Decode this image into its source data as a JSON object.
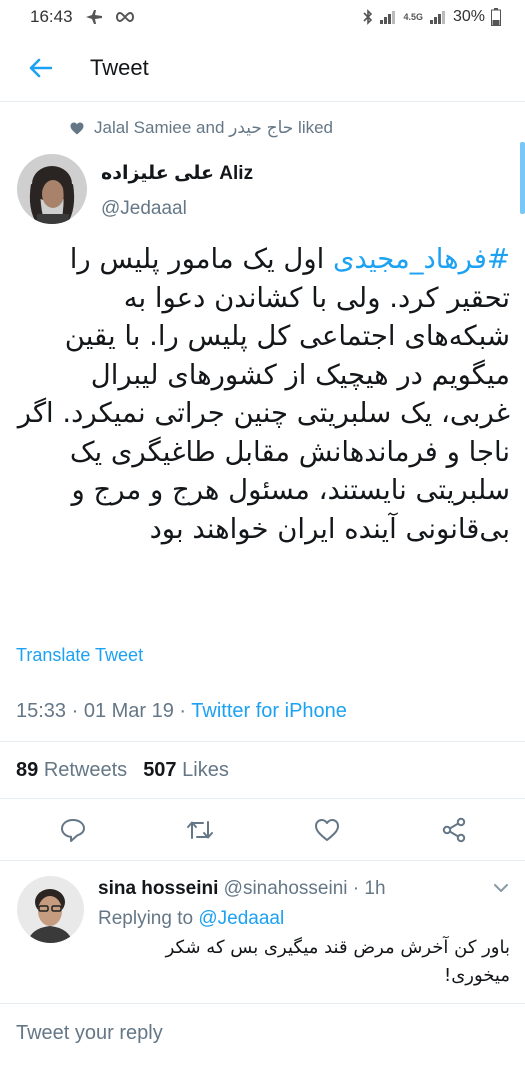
{
  "status_bar": {
    "time": "16:43",
    "network_label": "4.5G",
    "battery": "30%"
  },
  "app_bar": {
    "title": "Tweet"
  },
  "social_context": {
    "text": "Jalal Samiee and حاج حیدر liked"
  },
  "tweet": {
    "author_name": "علی علیزاده Aliz",
    "author_handle": "@Jedaaal",
    "hashtag": "#فرهاد_مجیدی",
    "body": " اول یک مامور پلیس را تحقیر کرد. ولی با کشاندن دعوا به شبکه‌های اجتماعی کل پلیس را. با یقین میگویم در هیچیک از کشورهای لیبرال غربی، یک سلبریتی چنین جراتی نمیکرد. اگر ناجا و فرماندهانش مقابل طاغیگری یک سلبریتی نایستند، مسئول هرج و مرج و بی‌قانونی آینده ایران خواهند بود",
    "translate_label": "Translate Tweet",
    "timestamp": "15:33 · 01 Mar 19 · ",
    "source": "Twitter for iPhone",
    "retweets_count": "89",
    "retweets_label": "Retweets",
    "likes_count": "507",
    "likes_label": "Likes"
  },
  "reply": {
    "name": "sina hosseini",
    "handle_time": " @sinahosseini · 1h",
    "replying_label": "Replying to ",
    "replying_handle": "@Jedaaal",
    "text": "باور کن آخرش مرض قند میگیری بس که شکر میخوری!"
  },
  "compose": {
    "placeholder": "Tweet your reply"
  },
  "colors": {
    "accent": "#1da1f2",
    "secondary_text": "#657786",
    "primary_text": "#14171a",
    "divider": "#e6ecf0"
  }
}
